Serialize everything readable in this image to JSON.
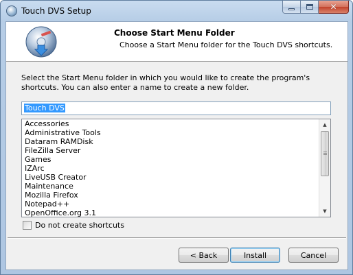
{
  "window": {
    "title": "Touch DVS Setup"
  },
  "header": {
    "title": "Choose Start Menu Folder",
    "subtitle": "Choose a Start Menu folder for the Touch DVS shortcuts."
  },
  "description": "Select the Start Menu folder in which you would like to create the program's shortcuts. You can also enter a name to create a new folder.",
  "folder_input": {
    "value": "Touch DVS"
  },
  "folder_list": {
    "items": [
      "Accessories",
      "Administrative Tools",
      "Dataram RAMDisk",
      "FileZilla Server",
      "Games",
      "IZArc",
      "LiveUSB Creator",
      "Maintenance",
      "Mozilla Firefox",
      "Notepad++",
      "OpenOffice.org 3.1"
    ]
  },
  "checkbox": {
    "label": "Do not create shortcuts",
    "checked": false
  },
  "buttons": {
    "back": "< Back",
    "install": "Install",
    "cancel": "Cancel"
  },
  "icons": {
    "app": "setup-disc-icon",
    "header": "installer-disc-icon"
  }
}
